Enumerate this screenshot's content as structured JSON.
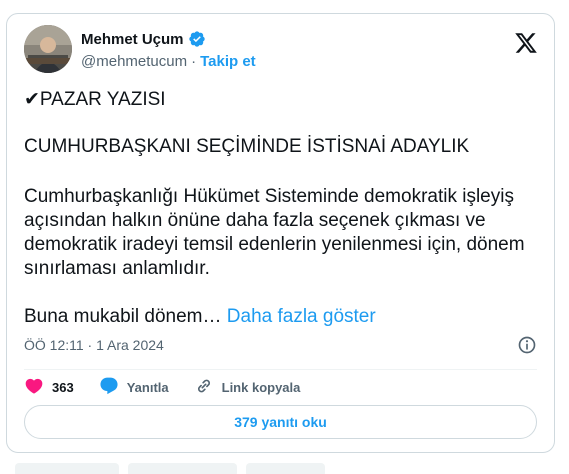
{
  "author": {
    "name": "Mehmet Uçum",
    "handle": "@mehmetucum",
    "separator": "·",
    "follow_label": "Takip et"
  },
  "tweet": {
    "line1": "✔PAZAR YAZISI",
    "line2": "CUMHURBAŞKANI SEÇİMİNDE İSTİSNAİ ADAYLIK",
    "paragraph": "Cumhurbaşkanlığı Hükümet Sisteminde demokratik işleyiş açısından halkın önüne daha fazla seçenek çıkması ve demokratik iradeyi temsil edenlerin yenilenmesi için, dönem sınırlaması anlamlıdır.",
    "truncated": "Buna mukabil dönem…",
    "show_more": "Daha fazla göster",
    "timestamp": "ÖÖ 12:11 · 1 Ara 2024"
  },
  "actions": {
    "likes": "363",
    "reply_label": "Yanıtla",
    "copy_link_label": "Link kopyala"
  },
  "replies_button": "379 yanıtı oku",
  "colors": {
    "accent": "#1d9bf0",
    "like": "#f91880",
    "text": "#0f1419",
    "muted": "#536471"
  }
}
